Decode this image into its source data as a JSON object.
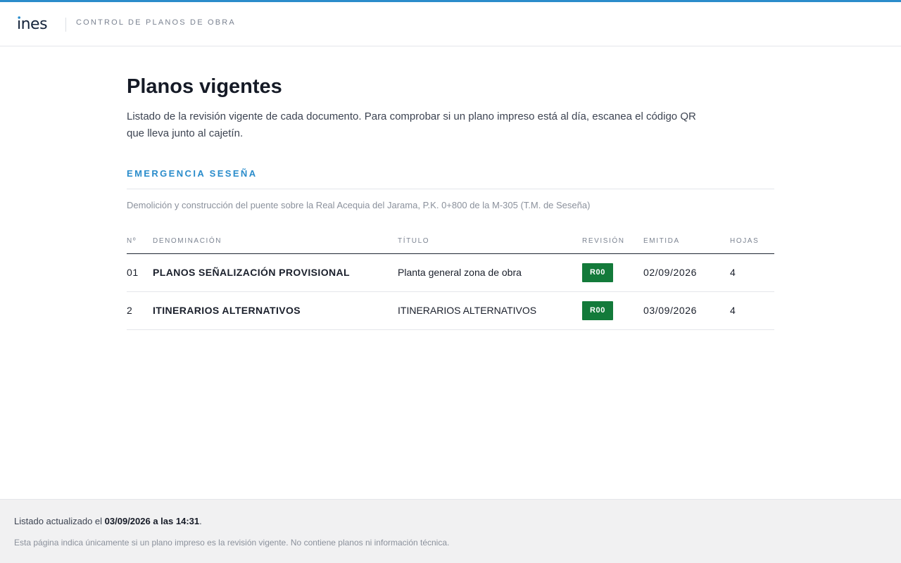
{
  "header": {
    "logo_text": "ines",
    "app_title": "CONTROL DE PLANOS DE OBRA"
  },
  "main": {
    "title": "Planos vigentes",
    "description": "Listado de la revisión vigente de cada documento. Para comprobar si un plano impreso está al día, escanea el código QR que lleva junto al cajetín.",
    "project": {
      "name": "EMERGENCIA SESEÑA",
      "description": "Demolición y construcción del puente sobre la Real Acequia del Jarama, P.K. 0+800 de la M-305 (T.M. de Seseña)"
    },
    "table": {
      "columns": [
        "Nº",
        "DENOMINACIÓN",
        "TÍTULO",
        "REVISIÓN",
        "EMITIDA",
        "HOJAS"
      ],
      "rows": [
        {
          "num": "01",
          "denominacion": "PLANOS SEÑALIZACIÓN PROVISIONAL",
          "titulo": "Planta general zona de obra",
          "revision": "R00",
          "emitida": "02/09/2026",
          "hojas": "4"
        },
        {
          "num": "2",
          "denominacion": "ITINERARIOS ALTERNATIVOS",
          "titulo": "ITINERARIOS ALTERNATIVOS",
          "revision": "R00",
          "emitida": "03/09/2026",
          "hojas": "4"
        }
      ]
    }
  },
  "footer": {
    "update_prefix": "Listado actualizado el ",
    "update_value": "03/09/2026 a las 14:31",
    "update_suffix": ".",
    "note": "Esta página indica únicamente si un plano impreso es la revisión vigente. No contiene planos ni información técnica."
  },
  "colors": {
    "accent": "#2a8ccb",
    "revision_badge": "#137a3a",
    "footer_bg": "#f1f1f2"
  }
}
